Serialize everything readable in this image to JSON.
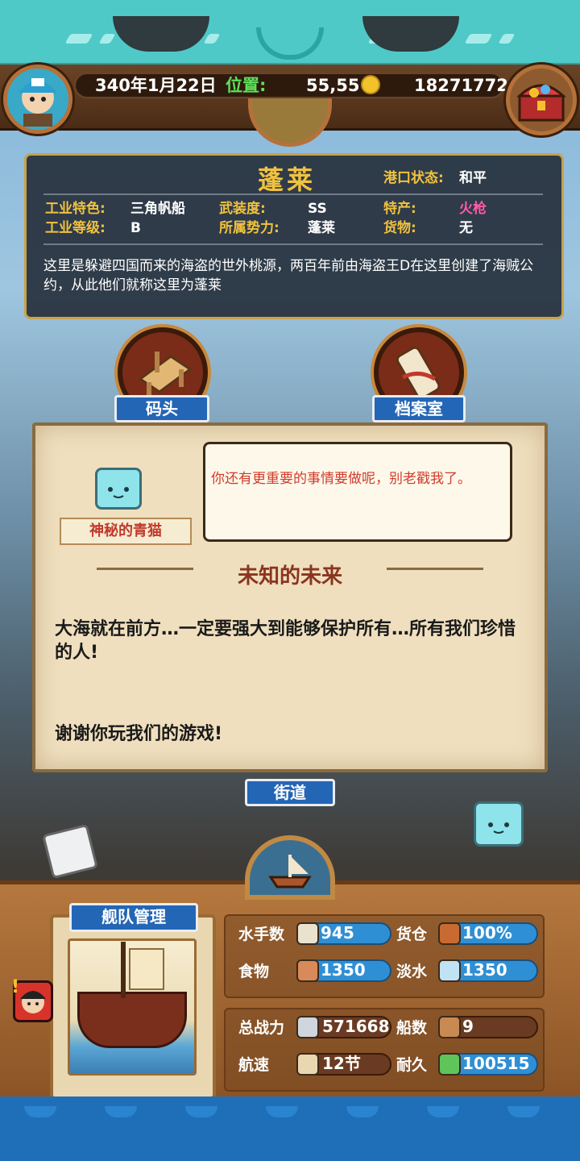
{
  "header": {
    "date": "340年1月22日",
    "position_label": "位置:",
    "position_value": "55,55",
    "gold": "18271772"
  },
  "port": {
    "name": "蓬莱",
    "status_label": "港口状态:",
    "status_value": "和平",
    "industry_label": "工业特色:",
    "industry_value": "三角帆船",
    "armament_label": "武装度:",
    "armament_value": "SS",
    "specialty_label": "特产:",
    "specialty_value": "火枪",
    "industry_level_label": "工业等级:",
    "industry_level_value": "B",
    "faction_label": "所属势力:",
    "faction_value": "蓬莱",
    "goods_label": "货物:",
    "goods_value": "无",
    "description": "这里是躲避四国而来的海盗的世外桃源，两百年前由海盗王D在这里创建了海贼公约，从此他们就称这里为蓬莱"
  },
  "buildings": {
    "dock_label": "码头",
    "archive_label": "档案室",
    "street_label": "街道"
  },
  "dialog": {
    "speaker": "神秘的青猫",
    "bubble": "你还有更重要的事情要做呢，别老戳我了。",
    "title": "未知的未来",
    "body": "大海就在前方…一定要强大到能够保护所有…所有我们珍惜的人!",
    "thanks": "谢谢你玩我们的游戏!"
  },
  "fleet": {
    "title": "舰队管理",
    "sailors_label": "水手数",
    "sailors_value": "945",
    "cargo_label": "货仓",
    "cargo_value": "100%",
    "food_label": "食物",
    "food_value": "1350",
    "water_label": "淡水",
    "water_value": "1350",
    "power_label": "总战力",
    "power_value": "571668",
    "ships_label": "船数",
    "ships_value": "9",
    "speed_label": "航速",
    "speed_value": "12节",
    "durability_label": "耐久",
    "durability_value": "100515"
  },
  "colors": {
    "accent_gold": "#f1c23f",
    "highlight_pink": "#ff5aa8",
    "banner_blue": "#2366b5",
    "teal": "#4ec9c7"
  },
  "icons": [
    "captain-avatar-icon",
    "treasure-chest-icon",
    "globe-icon",
    "coin-icon",
    "dock-icon",
    "scroll-icon",
    "blue-cat-icon",
    "white-cube-icon",
    "ship-compass-icon",
    "alert-icon",
    "sailor-icon",
    "cargo-icon",
    "meat-icon",
    "water-jug-icon",
    "swords-icon",
    "boat-icon",
    "sail-icon",
    "durability-icon"
  ]
}
